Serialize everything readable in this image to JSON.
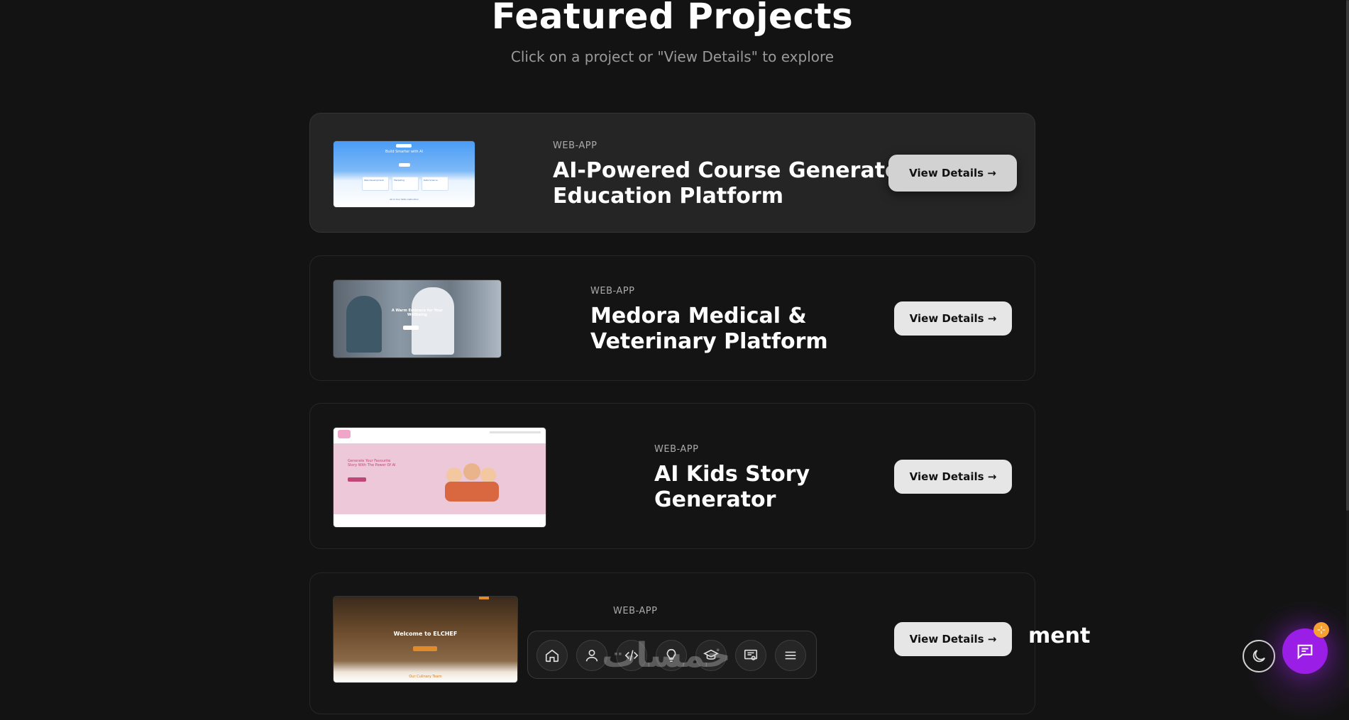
{
  "header": {
    "title": "Featured Projects",
    "subtitle": "Click on a project or \"View Details\" to explore"
  },
  "projects": [
    {
      "tag": "WEB-APP",
      "title_line1": "AI-Powered Course Generator &",
      "title_line2": "Education Platform",
      "button": "View Details →",
      "thumb": {
        "hero_line": "Build Smarter with AI",
        "cards": [
          "Web Development",
          "Marketing",
          "Data Science"
        ],
        "footer_note": "All In Your Skills Instruction"
      }
    },
    {
      "tag": "WEB-APP",
      "title_line1": "Medora Medical &",
      "title_line2": "Veterinary Platform",
      "button": "View Details →",
      "thumb": {
        "hero_line1": "A Warm Embrace for Your",
        "hero_line2": "Wellbeing",
        "cta": "Get Started"
      }
    },
    {
      "tag": "WEB-APP",
      "title_line1": "AI Kids Story",
      "title_line2": "Generator",
      "button": "View Details →",
      "thumb": {
        "headline1": "Generate Your Favourite",
        "headline2": "Story With The Power Of AI",
        "cta": "Get Started"
      }
    },
    {
      "tag": "WEB-APP",
      "title_line1": "ment",
      "title_line2": "",
      "button": "View Details →",
      "thumb": {
        "hero": "Welcome to ELCHEF",
        "section": "Our Culinary Team",
        "cta": "Book a Table"
      }
    }
  ],
  "bottom_nav": {
    "icons": [
      "home-icon",
      "user-icon",
      "code-icon",
      "lightbulb-icon",
      "graduation-cap-icon",
      "certificate-icon",
      "menu-icon"
    ],
    "watermark": "خمسات"
  },
  "floating": {
    "theme_icon": "moon-icon",
    "chat_icon": "chat-icon",
    "badge_icon": "sparkle-icon"
  },
  "colors": {
    "background": "#131313",
    "card_active": "#252525",
    "button": "#e6e6e6",
    "chat_accent": "#9b1ee6",
    "badge": "#f5a030"
  }
}
